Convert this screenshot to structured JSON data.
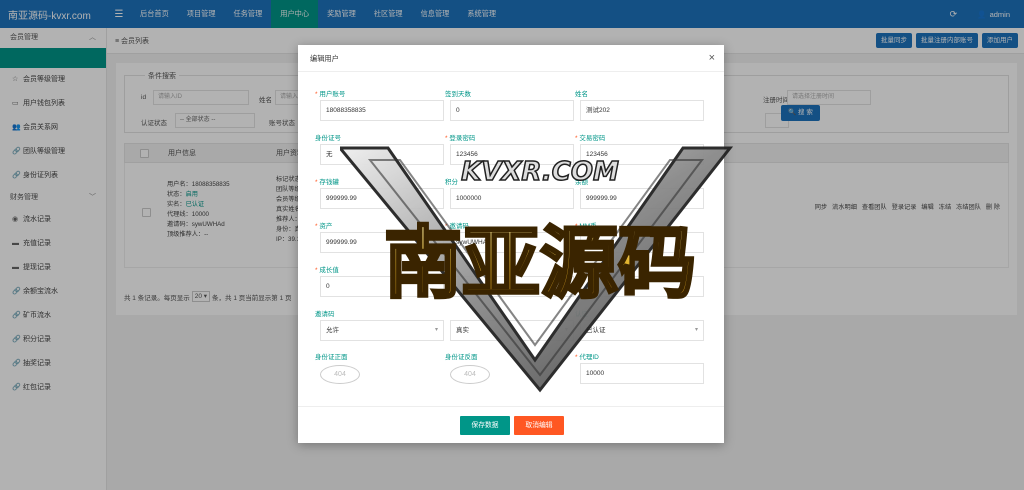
{
  "app": {
    "brand": "南亚源码-kvxr.com",
    "user": "admin"
  },
  "nav": [
    "后台首页",
    "项目管理",
    "任务管理",
    "用户中心",
    "奖励管理",
    "社区管理",
    "信息管理",
    "系统管理"
  ],
  "sidebar": {
    "group1": "会员管理",
    "items1": [
      "会员等级管理",
      "用户钱包列表",
      "会员关系网",
      "团队等级管理",
      "身份证列表"
    ],
    "group2": "财务管理",
    "items2": [
      "流水记录",
      "充值记录",
      "提现记录",
      "余额宝流水",
      "矿币流水",
      "积分记录",
      "抽奖记录",
      "红包记录"
    ]
  },
  "page": {
    "breadcrumb": "会员列表",
    "buttons": [
      "批量同步",
      "批量注册内部账号",
      "添加用户"
    ]
  },
  "search": {
    "legend": "条件搜索",
    "labels": {
      "id": "id",
      "name": "姓名",
      "auth": "认证状态",
      "acct": "账号状态",
      "regtime": "注册时间"
    },
    "placeholders": {
      "id": "请输入ID",
      "name": "请输入姓",
      "auth": "-- 全部状态 --",
      "regtime": "请选择注册时间"
    },
    "button": "搜 索"
  },
  "table": {
    "headers": [
      "用户信息",
      "用户资料"
    ],
    "row": {
      "info": [
        "用户名：18088358835",
        "状态：",
        "实名：",
        "代理线：10000",
        "邀请码：sywUWHAd",
        "顶级推荐人：--"
      ],
      "status": "启用",
      "realname": "已认证",
      "profile": [
        "标记状态：",
        "团队等级：",
        "会员等级：",
        "真实姓名：",
        "推荐人：0",
        "身份：真实",
        "IP：39.126"
      ],
      "ops": [
        "同步",
        "流水明细",
        "查看团队",
        "登录记录",
        "编辑",
        "冻结",
        "冻结团队",
        "删 除"
      ]
    },
    "pager": {
      "before": "共 1 条记录。每页显示",
      "size": "20",
      "after": "条，共 1 页当前显示第 1 页"
    }
  },
  "modal": {
    "title": "编辑用户",
    "fields": [
      {
        "label": "用户账号",
        "required": true,
        "value": "18088358835"
      },
      {
        "label": "签到天数",
        "required": false,
        "value": "0"
      },
      {
        "label": "姓名",
        "required": false,
        "value": "测试202"
      },
      {
        "label": "身份证号",
        "required": false,
        "value": "无"
      },
      {
        "label": "登录密码",
        "required": true,
        "value": "123456"
      },
      {
        "label": "交易密码",
        "required": true,
        "value": "123456"
      },
      {
        "label": "存钱罐",
        "required": true,
        "value": "999999.99"
      },
      {
        "label": "积分",
        "required": false,
        "value": "1000000"
      },
      {
        "label": "余额",
        "required": false,
        "value": "999999.99"
      },
      {
        "label": "资产",
        "required": true,
        "value": "999999.99"
      },
      {
        "label": "邀请码",
        "required": true,
        "value": "sywUWHAd"
      },
      {
        "label": "MM币",
        "required": true,
        "value": ""
      },
      {
        "label": "成长值",
        "required": true,
        "value": "0"
      },
      {
        "label": "",
        "required": false,
        "value": ""
      },
      {
        "label": "",
        "required": false,
        "value": ""
      },
      {
        "label": "邀请码",
        "required": false,
        "value": "允许"
      },
      {
        "label": "",
        "required": false,
        "value": "真实"
      },
      {
        "label": "认证",
        "required": false,
        "value": "已认证"
      },
      {
        "label": "身份证正面",
        "required": false,
        "value": "404"
      },
      {
        "label": "身份证反面",
        "required": false,
        "value": "404"
      },
      {
        "label": "代理ID",
        "required": true,
        "value": "10000"
      }
    ],
    "save": "保存数据",
    "cancel": "取消编辑"
  },
  "watermark": {
    "top": "KVXR.COM",
    "main": "南亚源码"
  },
  "colors": {
    "primary": "#1e73be",
    "teal": "#009688",
    "orange": "#ff5722"
  }
}
